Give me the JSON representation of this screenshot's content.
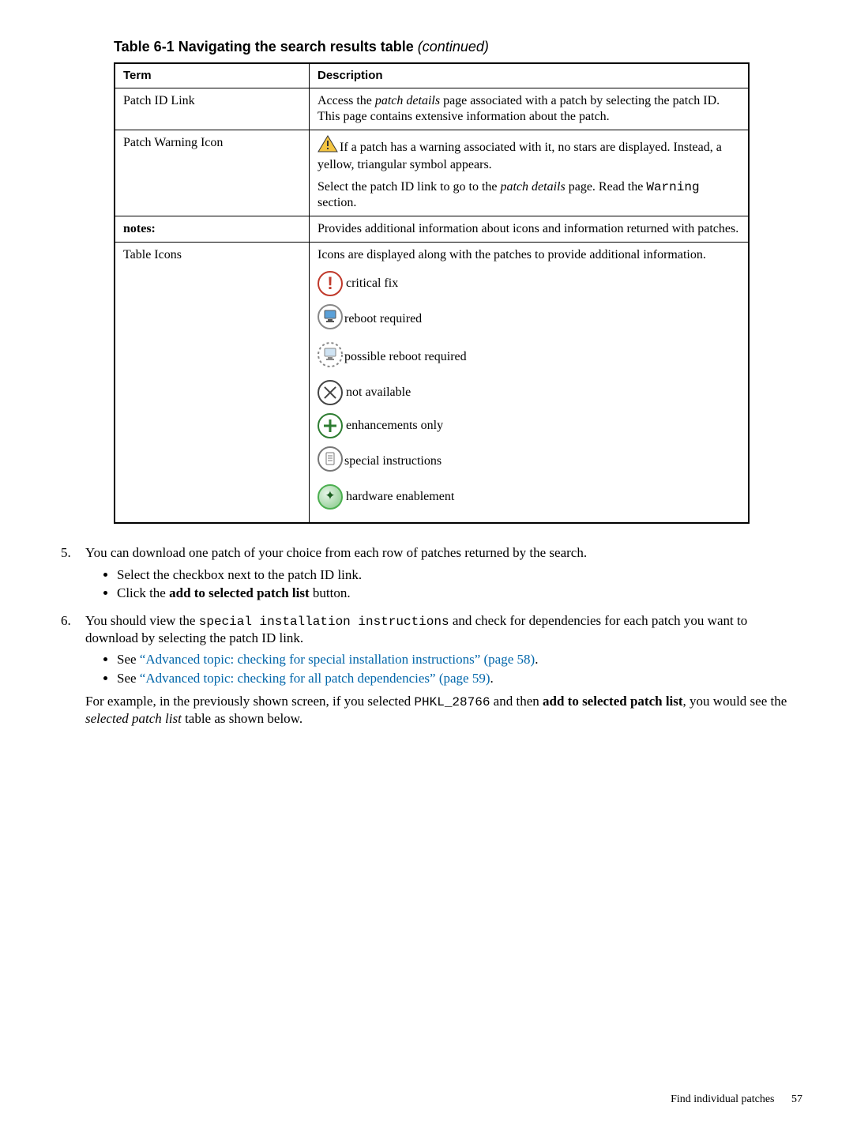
{
  "table_caption": {
    "prefix": "Table 6-1 Navigating the search results table",
    "suffix": " (continued)"
  },
  "header": {
    "term": "Term",
    "desc": "Description"
  },
  "rows": {
    "patch_id_link": {
      "term": "Patch ID Link",
      "desc_pre": "Access the ",
      "desc_em": "patch details",
      "desc_post": " page associated with a patch by selecting the patch ID. This page contains extensive information about the patch."
    },
    "patch_warning": {
      "term": "Patch Warning Icon",
      "desc1": "If a patch has a warning associated with it, no stars are displayed. Instead, a yellow, triangular symbol appears.",
      "desc2_pre": "Select the patch ID link to go to the ",
      "desc2_em": "patch details",
      "desc2_post": " page. Read the ",
      "desc2_mono": "Warning",
      "desc2_end": " section."
    },
    "notes": {
      "term": "notes:",
      "desc": "Provides additional information about icons and information returned with patches."
    },
    "table_icons": {
      "term": "Table Icons",
      "intro": "Icons are displayed along with the patches to provide additional information.",
      "icons": {
        "critical": "critical fix",
        "reboot": "reboot required",
        "possible": "possible reboot required",
        "not_avail": "not available",
        "enh": "enhancements only",
        "special": "special instructions",
        "hw": "hardware enablement"
      }
    }
  },
  "list": {
    "step5": {
      "text": "You can download one patch of your choice from each row of patches returned by the search.",
      "b1": "Select the checkbox next to the patch ID link.",
      "b2_pre": "Click the ",
      "b2_bold": "add to selected patch list",
      "b2_post": " button."
    },
    "step6": {
      "pre": "You should view the ",
      "mono": "special installation instructions",
      "post": " and check for dependencies for each patch you want to download by selecting the patch ID link.",
      "b1_pre": "See ",
      "b1_link": "“Advanced topic: checking for special installation instructions” (page 58)",
      "b1_post": ".",
      "b2_pre": "See ",
      "b2_link": "“Advanced topic: checking for all patch dependencies” (page 59)",
      "b2_post": ".",
      "para_pre": "For example, in the previously shown screen, if you selected ",
      "para_mono": "PHKL_28766",
      "para_mid": " and then ",
      "para_bold": "add to selected patch list",
      "para_mid2": ", you would see the ",
      "para_em": "selected patch list",
      "para_end": " table as shown below."
    }
  },
  "footer": {
    "text": "Find individual patches",
    "page": "57"
  }
}
